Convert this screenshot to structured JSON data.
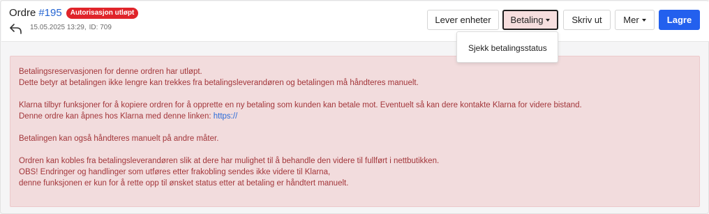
{
  "header": {
    "title": "Ordre",
    "order_number": "#195",
    "badge": "Autorisasjon utløpt",
    "date": "15.05.2025 13:29,",
    "id": "ID: 709"
  },
  "toolbar": {
    "lever": "Lever enheter",
    "betaling": "Betaling",
    "skriv": "Skriv ut",
    "mer": "Mer",
    "lagre": "Lagre"
  },
  "dropdown": {
    "item": "Sjekk betalingsstatus"
  },
  "alert": {
    "line1": "Betalingsreservasjonen for denne ordren har utløpt.",
    "line2": "Dette betyr at betalingen ikke lengre kan trekkes fra betalingsleverandøren og betalingen må håndteres manuelt.",
    "line3": "Klarna tilbyr funksjoner for å kopiere ordren for å opprette en ny betaling som kunden kan betale mot. Eventuelt så kan dere kontakte Klarna for videre bistand.",
    "line4": "Denne ordre kan åpnes hos Klarna med denne linken:",
    "link": "https://",
    "line5": "Betalingen kan også håndteres manuelt på andre måter.",
    "line6": "Ordren kan kobles fra betalingsleverandøren slik at dere har mulighet til å behandle den videre til fullført i nettbutikken.",
    "line7": "OBS! Endringer og handlinger som utføres etter frakobling sendes ikke videre til Klarna,",
    "line8": "denne funksjonen er kun for å rette opp til ønsket status etter at betaling er håndtert manuelt."
  },
  "colors": {
    "accent": "#2360ee",
    "badge": "#e0242a",
    "alert_bg": "#f2dcdd",
    "alert_text": "#a2363a",
    "link": "#2a6ad8"
  }
}
